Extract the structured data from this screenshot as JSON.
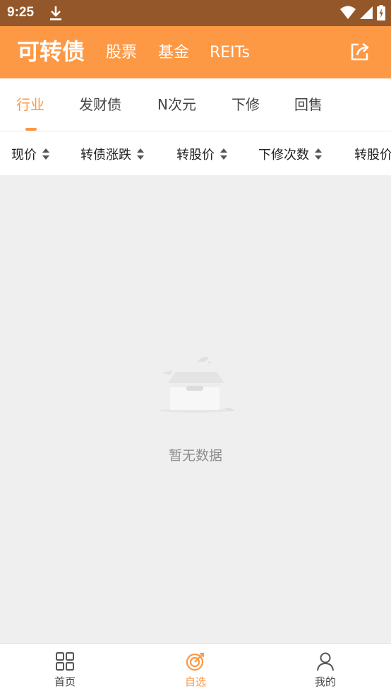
{
  "status_bar": {
    "time": "9:25"
  },
  "header": {
    "title": "可转债",
    "tabs": [
      "股票",
      "基金",
      "REITs"
    ]
  },
  "subtabs": [
    {
      "label": "行业",
      "active": true
    },
    {
      "label": "发财债",
      "active": false
    },
    {
      "label": "N次元",
      "active": false
    },
    {
      "label": "下修",
      "active": false
    },
    {
      "label": "回售",
      "active": false
    }
  ],
  "sort_columns": [
    "现价",
    "转债涨跌",
    "转股价",
    "下修次数",
    "转股价值"
  ],
  "empty_state": {
    "text": "暂无数据"
  },
  "bottom_nav": [
    {
      "label": "首页",
      "icon": "grid-icon",
      "active": false
    },
    {
      "label": "自选",
      "icon": "target-icon",
      "active": true
    },
    {
      "label": "我的",
      "icon": "user-icon",
      "active": false
    }
  ],
  "colors": {
    "accent": "#fd9845",
    "status_bar": "#94572a",
    "page_bg": "#efefef"
  }
}
